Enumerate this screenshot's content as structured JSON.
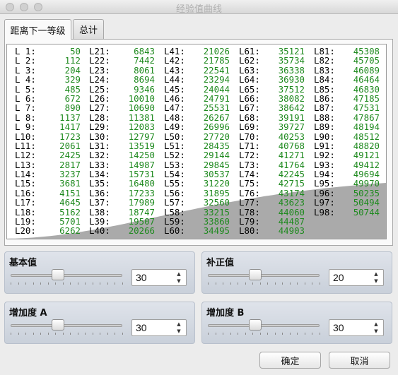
{
  "window": {
    "title": "经验值曲线"
  },
  "tabs": [
    {
      "label": "距离下一等级",
      "active": true
    },
    {
      "label": "总计",
      "active": false
    }
  ],
  "colors": {
    "value_text": "#1f8a1f",
    "curve_fill": "#aaaaaa"
  },
  "levels": [
    {
      "label": "L 1:",
      "value": "50"
    },
    {
      "label": "L 2:",
      "value": "112"
    },
    {
      "label": "L 3:",
      "value": "204"
    },
    {
      "label": "L 4:",
      "value": "329"
    },
    {
      "label": "L 5:",
      "value": "485"
    },
    {
      "label": "L 6:",
      "value": "672"
    },
    {
      "label": "L 7:",
      "value": "890"
    },
    {
      "label": "L 8:",
      "value": "1137"
    },
    {
      "label": "L 9:",
      "value": "1417"
    },
    {
      "label": "L10:",
      "value": "1723"
    },
    {
      "label": "L11:",
      "value": "2061"
    },
    {
      "label": "L12:",
      "value": "2425"
    },
    {
      "label": "L13:",
      "value": "2817"
    },
    {
      "label": "L14:",
      "value": "3237"
    },
    {
      "label": "L15:",
      "value": "3681"
    },
    {
      "label": "L16:",
      "value": "4151"
    },
    {
      "label": "L17:",
      "value": "4645"
    },
    {
      "label": "L18:",
      "value": "5162"
    },
    {
      "label": "L19:",
      "value": "5701"
    },
    {
      "label": "L20:",
      "value": "6262"
    },
    {
      "label": "L21:",
      "value": "6843"
    },
    {
      "label": "L22:",
      "value": "7442"
    },
    {
      "label": "L23:",
      "value": "8061"
    },
    {
      "label": "L24:",
      "value": "8694"
    },
    {
      "label": "L25:",
      "value": "9346"
    },
    {
      "label": "L26:",
      "value": "10010"
    },
    {
      "label": "L27:",
      "value": "10690"
    },
    {
      "label": "L28:",
      "value": "11381"
    },
    {
      "label": "L29:",
      "value": "12083"
    },
    {
      "label": "L30:",
      "value": "12797"
    },
    {
      "label": "L31:",
      "value": "13519"
    },
    {
      "label": "L32:",
      "value": "14250"
    },
    {
      "label": "L33:",
      "value": "14987"
    },
    {
      "label": "L34:",
      "value": "15731"
    },
    {
      "label": "L35:",
      "value": "16480"
    },
    {
      "label": "L36:",
      "value": "17233"
    },
    {
      "label": "L37:",
      "value": "17989"
    },
    {
      "label": "L38:",
      "value": "18747"
    },
    {
      "label": "L39:",
      "value": "19507"
    },
    {
      "label": "L40:",
      "value": "20266"
    },
    {
      "label": "L41:",
      "value": "21026"
    },
    {
      "label": "L42:",
      "value": "21785"
    },
    {
      "label": "L43:",
      "value": "22541"
    },
    {
      "label": "L44:",
      "value": "23294"
    },
    {
      "label": "L45:",
      "value": "24044"
    },
    {
      "label": "L46:",
      "value": "24791"
    },
    {
      "label": "L47:",
      "value": "25531"
    },
    {
      "label": "L48:",
      "value": "26267"
    },
    {
      "label": "L49:",
      "value": "26996"
    },
    {
      "label": "L50:",
      "value": "27720"
    },
    {
      "label": "L51:",
      "value": "28435"
    },
    {
      "label": "L52:",
      "value": "29144"
    },
    {
      "label": "L53:",
      "value": "29845"
    },
    {
      "label": "L54:",
      "value": "30537"
    },
    {
      "label": "L55:",
      "value": "31220"
    },
    {
      "label": "L56:",
      "value": "31895"
    },
    {
      "label": "L57:",
      "value": "32560"
    },
    {
      "label": "L58:",
      "value": "33215"
    },
    {
      "label": "L59:",
      "value": "33860"
    },
    {
      "label": "L60:",
      "value": "34495"
    },
    {
      "label": "L61:",
      "value": "35121"
    },
    {
      "label": "L62:",
      "value": "35734"
    },
    {
      "label": "L63:",
      "value": "36338"
    },
    {
      "label": "L64:",
      "value": "36930"
    },
    {
      "label": "L65:",
      "value": "37512"
    },
    {
      "label": "L66:",
      "value": "38082"
    },
    {
      "label": "L67:",
      "value": "38642"
    },
    {
      "label": "L68:",
      "value": "39191"
    },
    {
      "label": "L69:",
      "value": "39727"
    },
    {
      "label": "L70:",
      "value": "40253"
    },
    {
      "label": "L71:",
      "value": "40768"
    },
    {
      "label": "L72:",
      "value": "41271"
    },
    {
      "label": "L73:",
      "value": "41764"
    },
    {
      "label": "L74:",
      "value": "42245"
    },
    {
      "label": "L75:",
      "value": "42715"
    },
    {
      "label": "L76:",
      "value": "43174"
    },
    {
      "label": "L77:",
      "value": "43623"
    },
    {
      "label": "L78:",
      "value": "44060"
    },
    {
      "label": "L79:",
      "value": "44487"
    },
    {
      "label": "L80:",
      "value": "44903"
    },
    {
      "label": "L81:",
      "value": "45308"
    },
    {
      "label": "L82:",
      "value": "45705"
    },
    {
      "label": "L83:",
      "value": "46089"
    },
    {
      "label": "L84:",
      "value": "46464"
    },
    {
      "label": "L85:",
      "value": "46830"
    },
    {
      "label": "L86:",
      "value": "47185"
    },
    {
      "label": "L87:",
      "value": "47531"
    },
    {
      "label": "L88:",
      "value": "47867"
    },
    {
      "label": "L89:",
      "value": "48194"
    },
    {
      "label": "L90:",
      "value": "48512"
    },
    {
      "label": "L91:",
      "value": "48820"
    },
    {
      "label": "L92:",
      "value": "49121"
    },
    {
      "label": "L93:",
      "value": "49412"
    },
    {
      "label": "L94:",
      "value": "49694"
    },
    {
      "label": "L95:",
      "value": "49970"
    },
    {
      "label": "L96:",
      "value": "50235"
    },
    {
      "label": "L97:",
      "value": "50494"
    },
    {
      "label": "L98:",
      "value": "50744"
    }
  ],
  "controls": {
    "base": {
      "label": "基本值",
      "value": "30",
      "level": 0.3
    },
    "extra": {
      "label": "补正值",
      "value": "20",
      "level": 0.3
    },
    "accel_a": {
      "label": "增加度 A",
      "value": "30",
      "level": 0.3
    },
    "accel_b": {
      "label": "增加度 B",
      "value": "30",
      "level": 0.3
    }
  },
  "buttons": {
    "ok": "确定",
    "cancel": "取消"
  }
}
